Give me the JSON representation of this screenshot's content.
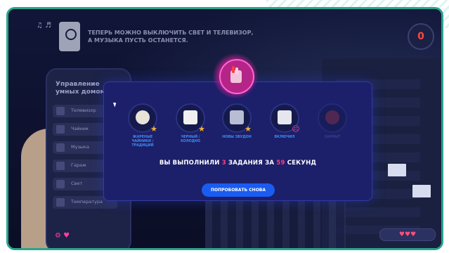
{
  "top_message": {
    "line1": "ТЕПЕРЬ МОЖНО ВЫКЛЮЧИТЬ СВЕТ И ТЕЛЕВИЗОР,",
    "line2": "А МУЗЫКА ПУСТЬ ОСТАНЕТСЯ."
  },
  "timer_value": "0",
  "phone": {
    "title": "Управление умных домом",
    "items": [
      "Телевизор",
      "Чайник",
      "Музыка",
      "Гараж",
      "Свет",
      "Температура"
    ]
  },
  "dialog": {
    "achievements": [
      {
        "label": "ЖАРЕНЫЕ ЧАЙНИКИ / ТРАДИЦИЙ",
        "status": "star"
      },
      {
        "label": "ЧЕРНЫЙ / ХОЛОДНО",
        "status": "star"
      },
      {
        "label": "НОВЫ ЗВУДОН",
        "status": "star"
      },
      {
        "label": "ВКЛЮЧИЛ",
        "status": "sad"
      },
      {
        "label": "ЗАКРЫТ",
        "status": "locked"
      }
    ],
    "result_prefix": "ВЫ ВЫПОЛНИЛИ",
    "result_count": "3",
    "result_middle": "ЗАДАНИЯ ЗА",
    "result_seconds": "59",
    "result_suffix": "СЕКУНД",
    "retry_button": "ПОПРОБОВАТЬ СНОВА"
  },
  "colors": {
    "frame_border": "#2aa58c",
    "dialog_bg": "#1c1f6a",
    "accent_pink": "#ff3f7e",
    "button_blue": "#1a5cf0",
    "star": "#f2b430"
  }
}
